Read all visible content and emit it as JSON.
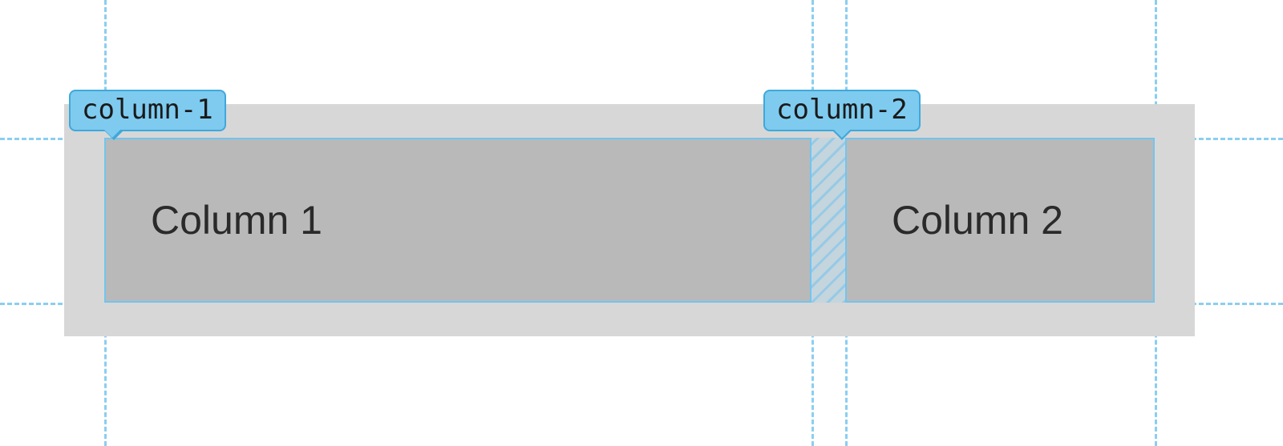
{
  "grid": {
    "track_labels": {
      "col1": "column-1",
      "col2": "column-2"
    },
    "cells": {
      "col1_content": "Column 1",
      "col2_content": "Column 2"
    }
  }
}
